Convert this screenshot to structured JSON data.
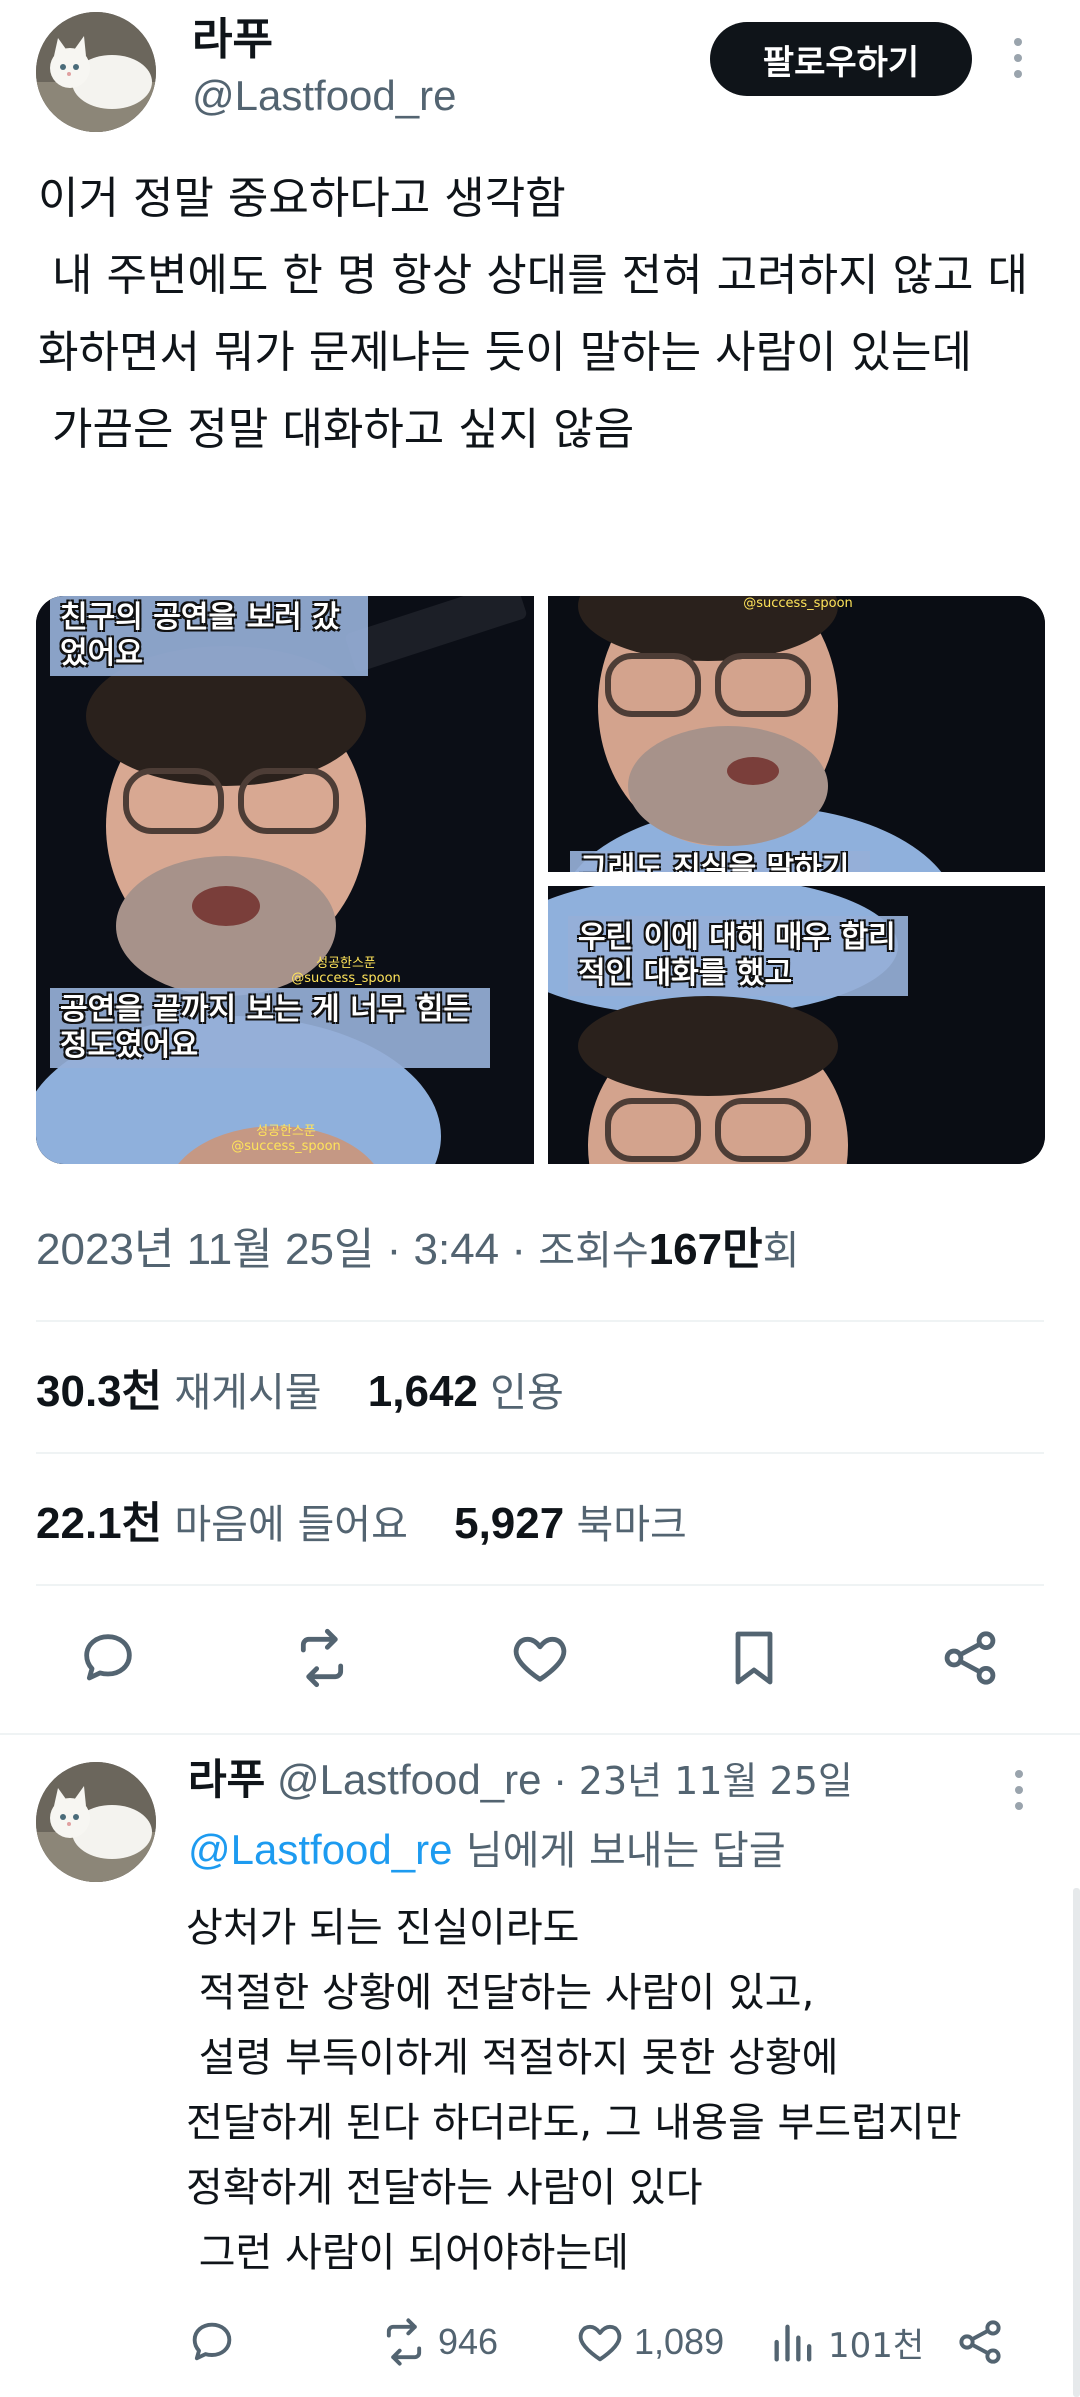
{
  "tweet": {
    "author": {
      "name": "라푸",
      "handle": "@Lastfood_re",
      "avatar_icon": "white-cat-avatar"
    },
    "follow_label": "팔로우하기",
    "more_icon": "more-vertical-icon",
    "text": "이거 정말 중요하다고 생각함\n 내 주변에도 한 명 항상 상대를 전혀 고려하지 않고 대화하면서 뭐가 문제냐는 듯이 말하는 사람이 있는데\n 가끔은 정말 대화하고 싶지 않음",
    "media": [
      {
        "caption_top": "친구의 공연을 보러\n갔었어요",
        "caption_bottom": "공연을 끝까지 보는 게\n너무 힘든 정도였어요",
        "watermark": "성공한스푼\n@success_spoon",
        "watermark_bottom": "성공한스푼\n@success_spoon"
      },
      {
        "caption_cut": "그래도 진실을 말하기는",
        "watermark": "@success_spoon"
      },
      {
        "caption": "우린 이에 대해 매우\n합리적인 대화를 했고"
      }
    ],
    "meta": {
      "date": "2023년 11월 25일",
      "sep": "·",
      "time": "3:44",
      "views_label": "조회수",
      "views_value": "167만",
      "views_suffix": "회"
    },
    "stats": {
      "retweets": "30.3천",
      "retweets_label": "재게시물",
      "quotes": "1,642",
      "quotes_label": "인용",
      "likes": "22.1천",
      "likes_label": "마음에 들어요",
      "bookmarks": "5,927",
      "bookmarks_label": "북마크"
    },
    "actions": [
      "reply-icon",
      "retweet-icon",
      "like-icon",
      "bookmark-icon",
      "share-icon"
    ]
  },
  "reply": {
    "author_name": "라푸",
    "handle": "@Lastfood_re",
    "sep": "·",
    "date": "23년 11월 25일",
    "reply_to_mention": "@Lastfood_re",
    "reply_to_text": "님에게 보내는 답글",
    "text": "상처가 되는 진실이라도\n 적절한 상황에 전달하는 사람이 있고,\n 설령 부득이하게 적절하지 못한 상황에\n전달하게 된다 하더라도, 그 내용을 부드럽지만\n정확하게 전달하는 사람이 있다\n 그런 사람이 되어야하는데",
    "actions": {
      "retweets": "946",
      "likes": "1,089",
      "views": "101천"
    }
  },
  "colors": {
    "text": "#0f1419",
    "secondary": "#536471",
    "link": "#1d9bf0",
    "divider": "#eff3f4",
    "button": "#0f1419"
  }
}
